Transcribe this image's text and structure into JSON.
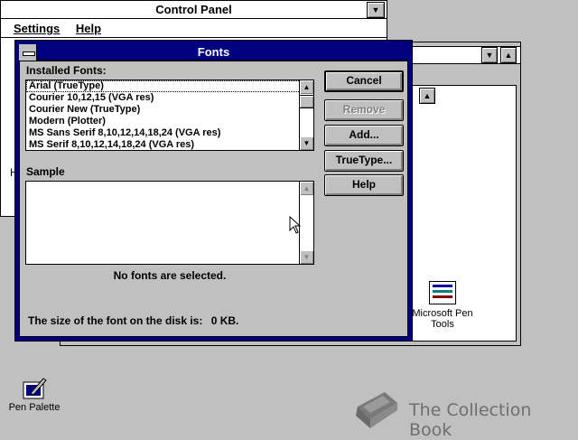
{
  "control_panel": {
    "title": "Control Panel",
    "menu": [
      {
        "label": "Settings",
        "accel_index": 0
      },
      {
        "label": "Help",
        "accel_index": 0
      }
    ]
  },
  "background_window": {
    "icon_label_1": "Microsoft Pen",
    "icon_label_2": "Tools",
    "partial_letter": "H"
  },
  "fonts_dialog": {
    "title": "Fonts",
    "installed_fonts_label": "Installed Fonts:",
    "fonts": [
      "Arial (TrueType)",
      "Courier 10,12,15 (VGA res)",
      "Courier New (TrueType)",
      "Modern (Plotter)",
      "MS Sans Serif 8,10,12,14,18,24 (VGA res)",
      "MS Serif 8,10,12,14,18,24 (VGA res)"
    ],
    "sample_label": "Sample",
    "no_selection_text": "No fonts are selected.",
    "disk_size_text": "The size of the font on the disk is:",
    "disk_size_value": "0 KB.",
    "buttons": {
      "cancel": "Cancel",
      "remove": "Remove",
      "add": "Add...",
      "truetype": "TrueType...",
      "help": "Help"
    }
  },
  "desktop": {
    "pen_palette_label": "Pen Palette",
    "watermark": "The Collection Book"
  }
}
